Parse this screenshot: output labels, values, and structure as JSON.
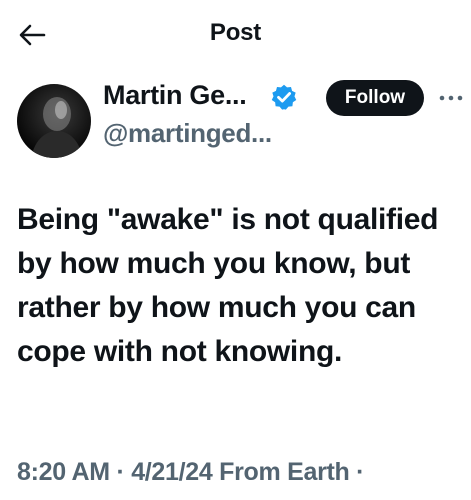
{
  "header": {
    "back_icon": "arrow-left-icon",
    "title": "Post"
  },
  "author": {
    "name": "Martin Ge...",
    "handle": "@martinged...",
    "verified_icon": "verified-badge-icon",
    "verified_color": "#1d9bf0",
    "follow_label": "Follow",
    "more_icon": "more-horizontal-icon"
  },
  "post": {
    "text": "Being \"awake\" is not qualified by how much you know, but rather by how much you can cope with not knowing.",
    "time": "8:20 AM",
    "date": "4/21/24",
    "source": "From Earth",
    "separator": "·"
  }
}
